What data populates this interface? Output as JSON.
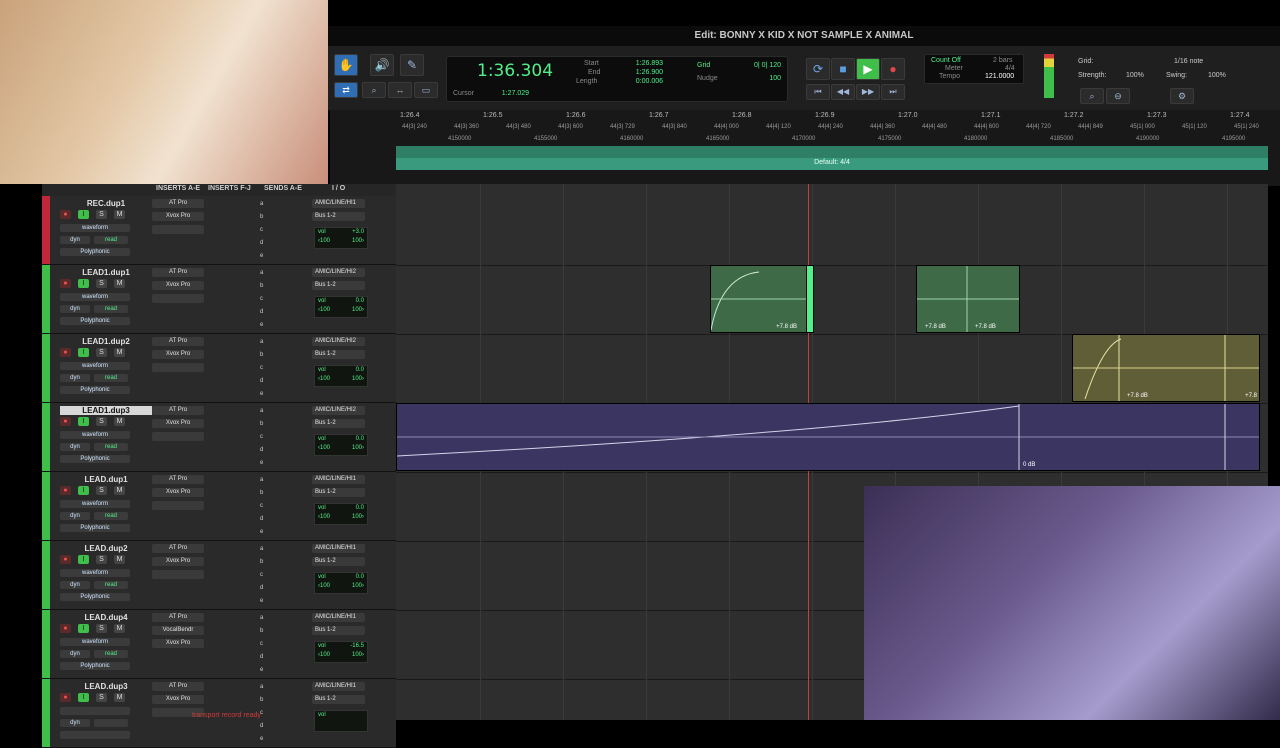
{
  "window": {
    "title": "Edit: BONNY X KID X NOT SAMPLE X ANIMAL"
  },
  "counter": {
    "main": "1:36.304",
    "start_label": "Start",
    "start_value": "1:26.893",
    "end_label": "End",
    "end_value": "1:26.900",
    "length_label": "Length",
    "length_value": "0:00.006",
    "cursor_label": "Cursor",
    "cursor_value": "1:27.029"
  },
  "grid_nudge": {
    "grid_label": "Grid",
    "grid_value": "0| 0| 120",
    "nudge_label": "Nudge",
    "nudge_value": "100"
  },
  "transport": {
    "count_off": "Count Off",
    "meter_label": "Meter",
    "meter_value": "4/4",
    "tempo_label": "Tempo",
    "tempo_value": "121.0000",
    "bars": "2 bars"
  },
  "grid_panel": {
    "grid_label": "Grid:",
    "grid_value": "1/16 note",
    "strength_label": "Strength:",
    "strength_value": "100%",
    "swing_label": "Swing:",
    "swing_value": "100%"
  },
  "ruler": {
    "minsecs": [
      "1:26.4",
      "1:26.5",
      "1:26.6",
      "1:26.7",
      "1:26.8",
      "1:26.9",
      "1:27.0",
      "1:27.1",
      "1:27.2",
      "1:27.3",
      "1:27.4"
    ],
    "bars": [
      "44|3| 240",
      "44|3| 360",
      "44|3| 480",
      "44|3| 600",
      "44|3| 729",
      "44|3| 840",
      "44|4| 000",
      "44|4| 120",
      "44|4| 240",
      "44|4| 360",
      "44|4| 480",
      "44|4| 600",
      "44|4| 720",
      "44|4| 849",
      "45|1| 000",
      "45|1| 120",
      "45|1| 240"
    ],
    "samples": [
      "4150000",
      "4155000",
      "4160000",
      "4165000",
      "4170000",
      "4175000",
      "4180000",
      "4185000",
      "4190000",
      "4195000"
    ],
    "meter_marker": "Default: 4/4"
  },
  "columns": {
    "inserts_ae": "INSERTS A-E",
    "inserts_fj": "INSERTS F-J",
    "sends_ae": "SENDS A-E",
    "io": "I / O"
  },
  "tracks": [
    {
      "name": "REC.dup1",
      "color": "#c0283a",
      "insert1": "AT Pro",
      "insert2": "Xvox Pro",
      "insert3": "",
      "io_in": "AMIC/LINE/HI1",
      "io_out": "Bus 1-2",
      "vol": "+3.0",
      "pan_l": "‹100",
      "pan_r": "100›",
      "view": "waveform",
      "auto": "read",
      "timebase": "Polyphonic"
    },
    {
      "name": "LEAD1.dup1",
      "color": "#3fbf4a",
      "insert1": "AT Pro",
      "insert2": "Xvox Pro",
      "insert3": "",
      "io_in": "AMIC/LINE/HI2",
      "io_out": "Bus 1-2",
      "vol": "0.0",
      "pan_l": "‹100",
      "pan_r": "100›",
      "view": "waveform",
      "auto": "read",
      "timebase": "Polyphonic"
    },
    {
      "name": "LEAD1.dup2",
      "color": "#3fbf4a",
      "insert1": "AT Pro",
      "insert2": "Xvox Pro",
      "insert3": "",
      "io_in": "AMIC/LINE/HI2",
      "io_out": "Bus 1-2",
      "vol": "0.0",
      "pan_l": "‹100",
      "pan_r": "100›",
      "view": "waveform",
      "auto": "read",
      "timebase": "Polyphonic"
    },
    {
      "name": "LEAD1.dup3",
      "color": "#3fbf4a",
      "insert1": "AT Pro",
      "insert2": "Xvox Pro",
      "insert3": "",
      "io_in": "AMIC/LINE/HI2",
      "io_out": "Bus 1-2",
      "vol": "0.0",
      "pan_l": "‹100",
      "pan_r": "100›",
      "view": "waveform",
      "auto": "read",
      "timebase": "Polyphonic"
    },
    {
      "name": "LEAD.dup1",
      "color": "#3fbf4a",
      "insert1": "AT Pro",
      "insert2": "Xvox Pro",
      "insert3": "",
      "io_in": "AMIC/LINE/HI1",
      "io_out": "Bus 1-2",
      "vol": "0.0",
      "pan_l": "‹100",
      "pan_r": "100›",
      "view": "waveform",
      "auto": "read",
      "timebase": "Polyphonic"
    },
    {
      "name": "LEAD.dup2",
      "color": "#3fbf4a",
      "insert1": "AT Pro",
      "insert2": "Xvox Pro",
      "insert3": "",
      "io_in": "AMIC/LINE/HI1",
      "io_out": "Bus 1-2",
      "vol": "0.0",
      "pan_l": "‹100",
      "pan_r": "100›",
      "view": "waveform",
      "auto": "read",
      "timebase": "Polyphonic"
    },
    {
      "name": "LEAD.dup4",
      "color": "#3fbf4a",
      "insert1": "AT Pro",
      "insert2": "VocalBendr",
      "insert3": "Xvox Pro",
      "io_in": "AMIC/LINE/HI1",
      "io_out": "Bus 1-2",
      "vol": "-16.5",
      "pan_l": "‹100",
      "pan_r": "100›",
      "view": "waveform",
      "auto": "read",
      "timebase": "Polyphonic"
    },
    {
      "name": "LEAD.dup3",
      "color": "#3fbf4a",
      "insert1": "AT Pro",
      "insert2": "Xvox Pro",
      "insert3": "",
      "io_in": "AMIC/LINE/HI1",
      "io_out": "Bus 1-2",
      "vol": "",
      "pan_l": "",
      "pan_r": "",
      "view": "",
      "auto": "",
      "timebase": ""
    }
  ],
  "clips": {
    "gain_a": "+7.8 dB",
    "gain_b": "+7.8 dB",
    "gain_c": "+7.8 dB",
    "gain_d": "+7.8 dB",
    "gain_e": "+7.8",
    "gain_f": "0 dB"
  },
  "status": {
    "message": "transport record ready"
  },
  "labels": {
    "dyn": "dyn",
    "vol": "vol",
    "rec": "●",
    "input": "I",
    "solo": "S",
    "mute": "M"
  }
}
